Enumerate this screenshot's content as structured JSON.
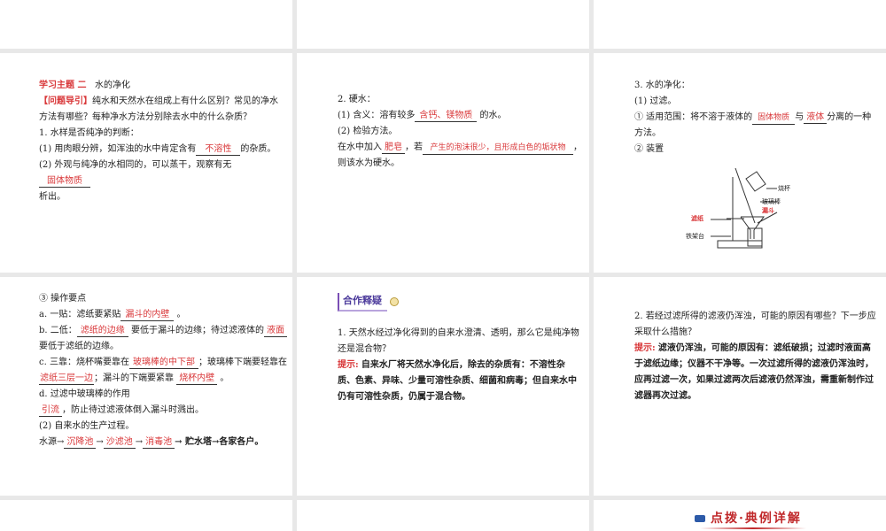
{
  "p1": {
    "topic_label": "学习主题 二",
    "topic_title": "水的净化",
    "guide_label": "【问题导引】",
    "guide_text": "纯水和天然水在组成上有什么区别？常见的净水方法有哪些？每种净水方法分别除去水中的什么杂质？",
    "q1": "1. 水样是否纯净的判断：",
    "q1a_pre": "(1) 用肉眼分辨，如浑浊的水中肯定含有",
    "q1a_ans": "不溶性",
    "q1a_post": "的杂质。",
    "q1b_pre": "(2) 外观与纯净的水相同的，可以蒸干，观察有无",
    "q1b_ans": "固体物质",
    "q1b_post": "析出。"
  },
  "p2": {
    "title": "2. 硬水：",
    "a_pre": "(1) 含义：溶有较多",
    "a_ans": "含钙、镁物质",
    "a_post": "的水。",
    "b": "(2) 检验方法。",
    "c_pre": "在水中加入",
    "c_ans1": "肥皂",
    "c_mid": "，若",
    "c_ans2": "产生的泡沫很少，且形成白色的垢状物",
    "c_post": "，",
    "d": "则该水为硬水。"
  },
  "p3": {
    "title": "3. 水的净化：",
    "sub": "(1) 过滤。",
    "scope_pre": "① 适用范围：将不溶于液体的",
    "scope_ans1": "固体物质",
    "scope_mid": "与",
    "scope_ans2": "液体",
    "scope_post": "分离的一种方法。",
    "device": "② 装置",
    "labels": {
      "beaker": "烧杯",
      "rod": "玻璃棒",
      "funnel": "漏斗",
      "paper": "滤纸",
      "stand": "铁架台"
    }
  },
  "p4": {
    "title": "③ 操作要点",
    "a_pre": "a. 一贴：滤纸要紧贴",
    "a_ans": "漏斗的内壁",
    "a_post": "。",
    "b_pre": "b. 二低：",
    "b_ans1": "滤纸的边缘",
    "b_mid": "要低于漏斗的边缘；待过滤液体的",
    "b_ans2": "液面",
    "b_post": "要低于滤纸的边缘。",
    "c_pre": "c. 三靠：烧杯嘴要靠在",
    "c_ans1": "玻璃棒的中下部",
    "c_mid1": "；玻璃棒下端要轻靠在",
    "c_ans2": "滤纸三层一边",
    "c_mid2": "；漏斗的下端要紧靠",
    "c_ans3": "烧杯内壁",
    "c_post": "。",
    "d": "d. 过滤中玻璃棒的作用",
    "d_ans": "引流",
    "d_post": "，防止待过滤液体倒入漏斗时溅出。",
    "e": "(2) 自来水的生产过程。",
    "f_pre": "水源→",
    "f_ans1": "沉降池",
    "f_ans2": "沙滤池",
    "f_ans3": "消毒池",
    "arrow": "→",
    "f_post": "→ 贮水塔→各家各户。"
  },
  "p5": {
    "badge": "合作释疑",
    "q": "1. 天然水经过净化得到的自来水澄清、透明，那么它是纯净物还是混合物？",
    "tip_label": "提示:",
    "tip": "自来水厂将天然水净化后，除去的杂质有：不溶性杂质、色素、异味、少量可溶性杂质、细菌和病毒；但自来水中仍有可溶性杂质，仍属于混合物。"
  },
  "p6": {
    "q": "2. 若经过滤所得的滤液仍浑浊，可能的原因有哪些？下一步应采取什么措施？",
    "tip_label": "提示:",
    "tip": "滤液仍浑浊，可能的原因有：滤纸破损；过滤时液面高于滤纸边缘；仪器不干净等。一次过滤所得的滤液仍浑浊时，应再过滤一次，如果过滤两次后滤液仍然浑浊，需重新制作过滤器再次过滤。"
  },
  "p9": {
    "banner": "点拨·典例详解"
  }
}
